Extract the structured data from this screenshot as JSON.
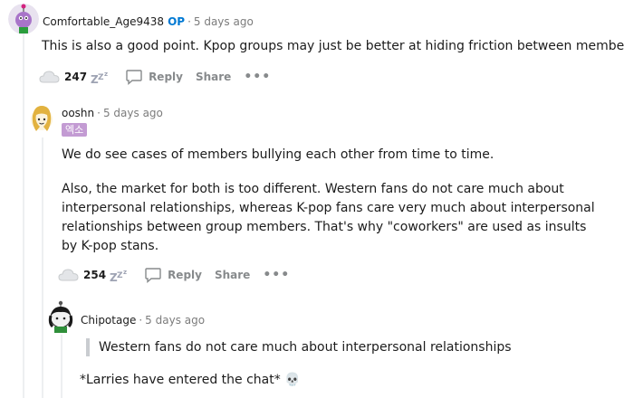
{
  "comments": [
    {
      "username": "Comfortable_Age9438",
      "op_badge": "OP",
      "time": "5 days ago",
      "text": "This is also a good point. Kpop groups may just be better at hiding friction between members",
      "score": "247",
      "reply_label": "Reply",
      "share_label": "Share"
    },
    {
      "username": "ooshn",
      "time": "5 days ago",
      "flair": "엑소",
      "paragraphs": [
        "We do see cases of members bullying each other from time to time.",
        "Also, the market for both is too different. Western fans do not care much about interpersonal relationships, whereas K-pop fans care very much about interpersonal relationships between group members. That's why \"coworkers\" are used as insults by K-pop stans."
      ],
      "score": "254",
      "reply_label": "Reply",
      "share_label": "Share"
    },
    {
      "username": "Chipotage",
      "time": "5 days ago",
      "quote": "Western fans do not care much about interpersonal relationships",
      "text": "*Larries have entered the chat*",
      "emoji": "💀"
    }
  ],
  "colors": {
    "op_blue": "#0079d3",
    "meta_gray": "#7c7c7c",
    "action_gray": "#878a8c",
    "thread_line": "#edeff1",
    "flair_bg": "#c39bd3"
  },
  "icons": [
    "upvote-cloud-icon",
    "sleep-award-icon",
    "comment-bubble-icon",
    "more-options-icon",
    "skull-emoji"
  ]
}
